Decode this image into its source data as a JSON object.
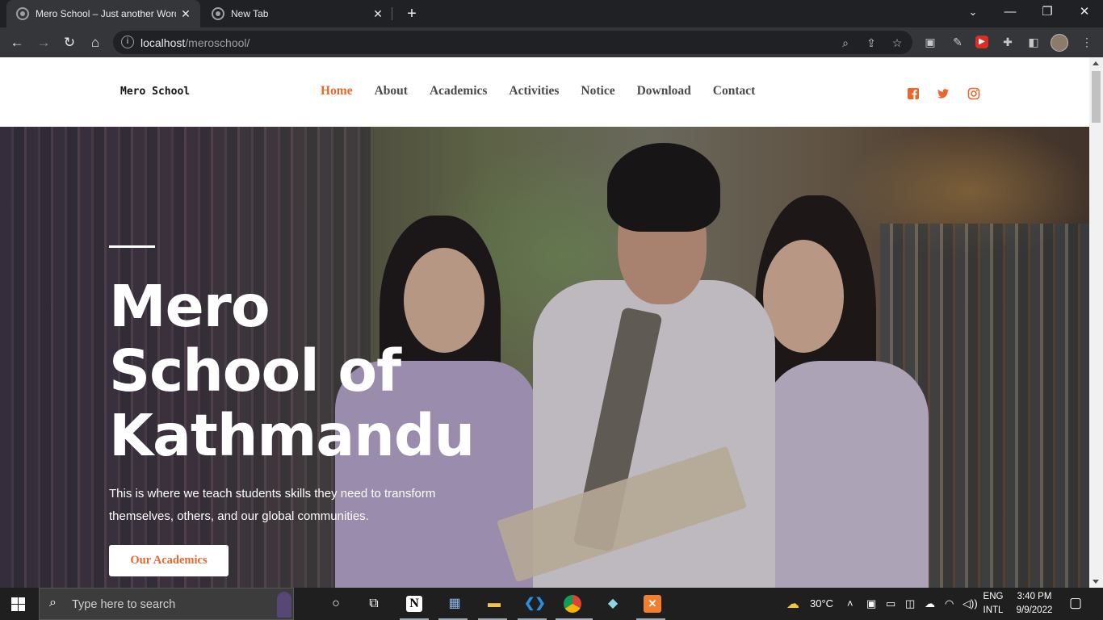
{
  "browser": {
    "tabs": [
      {
        "title": "Mero School – Just another WordPress site",
        "active": true
      },
      {
        "title": "New Tab",
        "active": false
      }
    ],
    "new_tab_label": "+",
    "url_host": "localhost",
    "url_path": "/meroschool/",
    "controls": {
      "minimize": "—",
      "restore": "❐",
      "close": "✕",
      "menu": "⌄"
    }
  },
  "site": {
    "logo": "Mero School",
    "nav": [
      "Home",
      "About",
      "Academics",
      "Activities",
      "Notice",
      "Download",
      "Contact"
    ],
    "active_nav": "Home",
    "accent_color": "#e8672c",
    "social": [
      "facebook-icon",
      "twitter-icon",
      "instagram-icon"
    ],
    "hero": {
      "title_line1": "Mero",
      "title_line2": "School of",
      "title_line3": "Kathmandu",
      "subtitle": "This is where we teach students skills they need to transform themselves, others, and our global communities.",
      "button": "Our Academics"
    }
  },
  "taskbar": {
    "search_placeholder": "Type here to search",
    "weather": "30°C",
    "lang_line1": "ENG",
    "lang_line2": "INTL",
    "time": "3:40 PM",
    "date": "9/9/2022"
  }
}
